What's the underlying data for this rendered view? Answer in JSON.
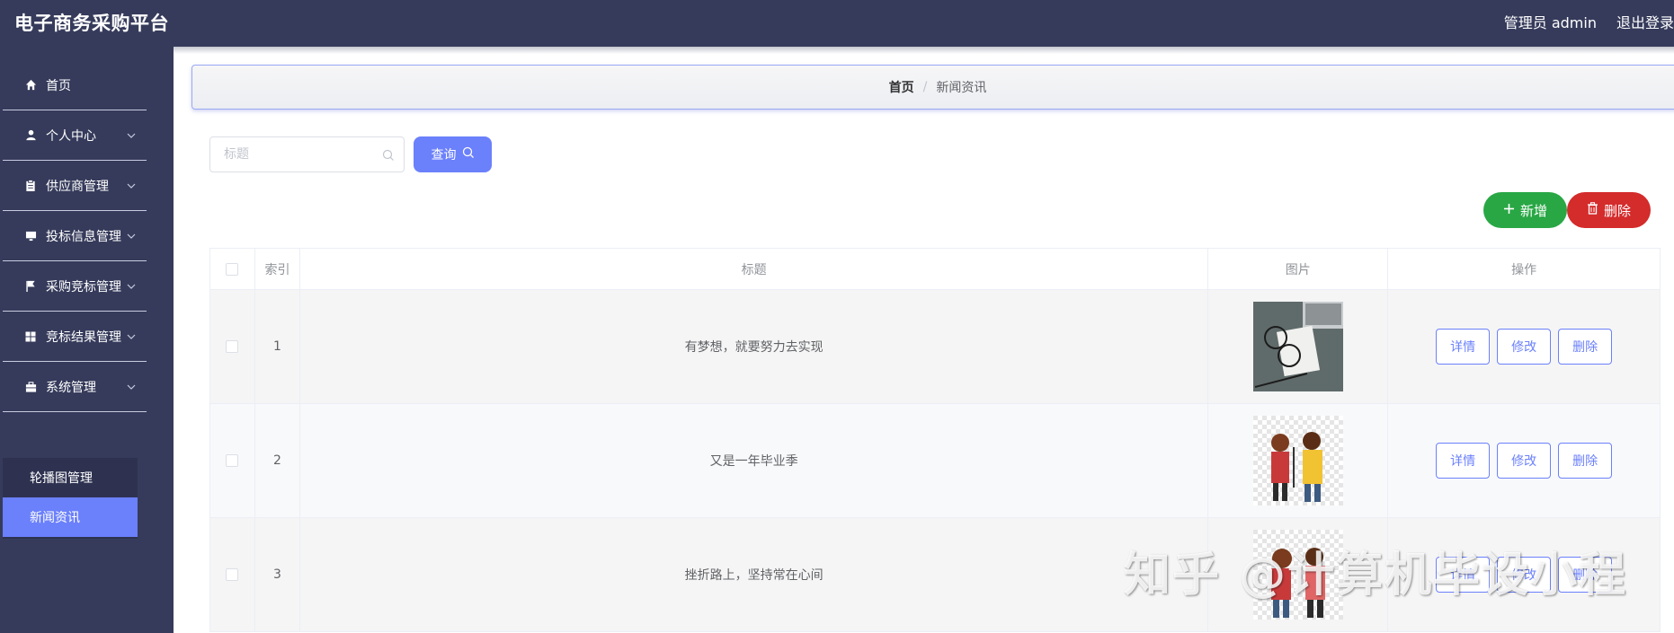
{
  "header": {
    "app_title": "电子商务采购平台",
    "user_label": "管理员 admin",
    "logout_label": "退出登录"
  },
  "sidebar": {
    "items": [
      {
        "label": "首页",
        "icon": "home-icon"
      },
      {
        "label": "个人中心",
        "icon": "user-icon"
      },
      {
        "label": "供应商管理",
        "icon": "clipboard-icon"
      },
      {
        "label": "投标信息管理",
        "icon": "monitor-icon"
      },
      {
        "label": "采购竞标管理",
        "icon": "flag-icon"
      },
      {
        "label": "竞标结果管理",
        "icon": "grid-icon"
      },
      {
        "label": "系统管理",
        "icon": "briefcase-icon"
      }
    ],
    "subitems": [
      {
        "label": "轮播图管理"
      },
      {
        "label": "新闻资讯"
      }
    ]
  },
  "breadcrumb": {
    "home": "首页",
    "separator": "/",
    "current": "新闻资讯"
  },
  "search": {
    "placeholder": "标题",
    "query_label": "查询"
  },
  "actions": {
    "add_label": "新增",
    "delete_label": "删除"
  },
  "table": {
    "headers": {
      "index": "索引",
      "title": "标题",
      "image": "图片",
      "ops": "操作"
    },
    "rows": [
      {
        "index": "1",
        "title": "有梦想，就要努力去实现"
      },
      {
        "index": "2",
        "title": "又是一年毕业季"
      },
      {
        "index": "3",
        "title": "挫折路上，坚持常在心间"
      }
    ],
    "op_labels": {
      "detail": "详情",
      "edit": "修改",
      "delete": "删除"
    }
  },
  "watermark": "知乎 @计算机毕设小程",
  "colors": {
    "sidebar_bg": "#363b5b",
    "accent": "#6b80fb",
    "add_green": "#29a745",
    "delete_red": "#d42b2b"
  }
}
